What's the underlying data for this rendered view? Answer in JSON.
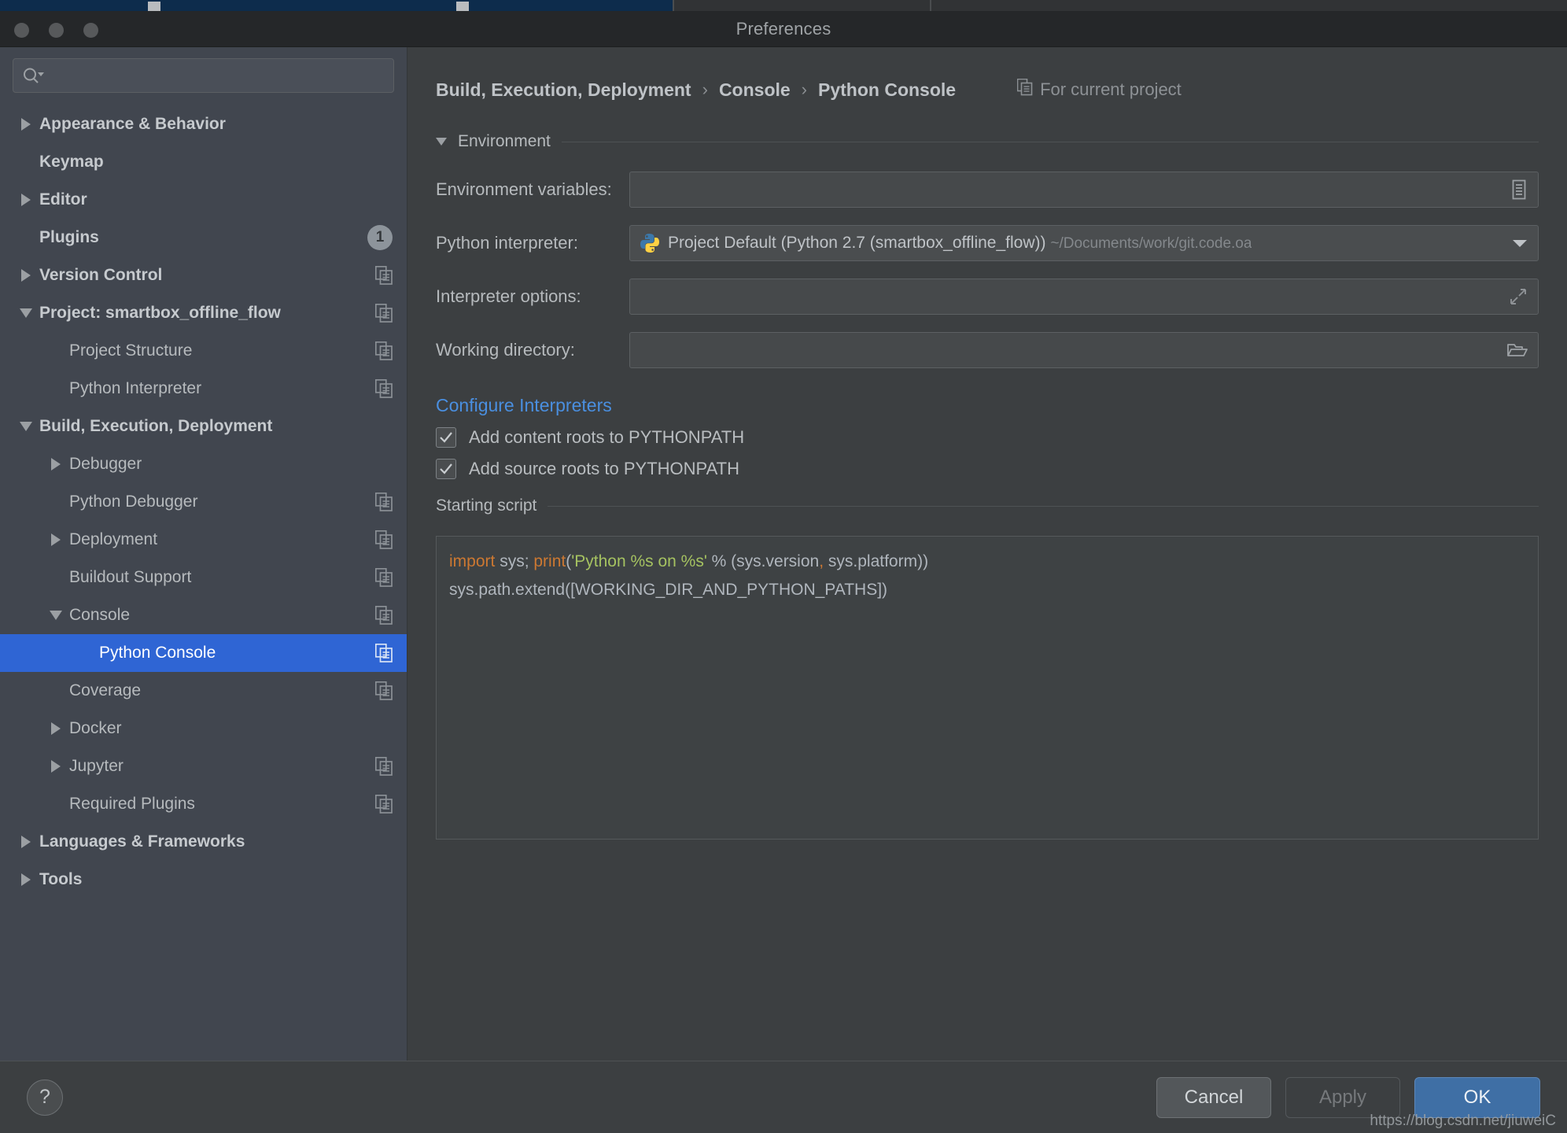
{
  "window": {
    "title": "Preferences",
    "traffic_lights": [
      "close-button",
      "minimize-button",
      "zoom-button"
    ]
  },
  "sidebar": {
    "search": {
      "value": "",
      "placeholder": ""
    },
    "items": [
      {
        "label": "Appearance & Behavior",
        "indent": 0,
        "twisty": "right",
        "bold": true,
        "copy": false,
        "badge": null,
        "selected": false
      },
      {
        "label": "Keymap",
        "indent": 0,
        "twisty": "none",
        "bold": true,
        "copy": false,
        "badge": null,
        "selected": false
      },
      {
        "label": "Editor",
        "indent": 0,
        "twisty": "right",
        "bold": true,
        "copy": false,
        "badge": null,
        "selected": false
      },
      {
        "label": "Plugins",
        "indent": 0,
        "twisty": "none",
        "bold": true,
        "copy": false,
        "badge": "1",
        "selected": false
      },
      {
        "label": "Version Control",
        "indent": 0,
        "twisty": "right",
        "bold": true,
        "copy": true,
        "badge": null,
        "selected": false
      },
      {
        "label": "Project: smartbox_offline_flow",
        "indent": 0,
        "twisty": "down",
        "bold": true,
        "copy": true,
        "badge": null,
        "selected": false
      },
      {
        "label": "Project Structure",
        "indent": 1,
        "twisty": "none",
        "bold": false,
        "copy": true,
        "badge": null,
        "selected": false
      },
      {
        "label": "Python Interpreter",
        "indent": 1,
        "twisty": "none",
        "bold": false,
        "copy": true,
        "badge": null,
        "selected": false
      },
      {
        "label": "Build, Execution, Deployment",
        "indent": 0,
        "twisty": "down",
        "bold": true,
        "copy": false,
        "badge": null,
        "selected": false
      },
      {
        "label": "Debugger",
        "indent": 1,
        "twisty": "right",
        "bold": false,
        "copy": false,
        "badge": null,
        "selected": false
      },
      {
        "label": "Python Debugger",
        "indent": 1,
        "twisty": "none",
        "bold": false,
        "copy": true,
        "badge": null,
        "selected": false
      },
      {
        "label": "Deployment",
        "indent": 1,
        "twisty": "right",
        "bold": false,
        "copy": true,
        "badge": null,
        "selected": false
      },
      {
        "label": "Buildout Support",
        "indent": 1,
        "twisty": "none",
        "bold": false,
        "copy": true,
        "badge": null,
        "selected": false
      },
      {
        "label": "Console",
        "indent": 1,
        "twisty": "down",
        "bold": false,
        "copy": true,
        "badge": null,
        "selected": false
      },
      {
        "label": "Python Console",
        "indent": 2,
        "twisty": "none",
        "bold": false,
        "copy": true,
        "badge": null,
        "selected": true
      },
      {
        "label": "Coverage",
        "indent": 1,
        "twisty": "none",
        "bold": false,
        "copy": true,
        "badge": null,
        "selected": false
      },
      {
        "label": "Docker",
        "indent": 1,
        "twisty": "right",
        "bold": false,
        "copy": false,
        "badge": null,
        "selected": false
      },
      {
        "label": "Jupyter",
        "indent": 1,
        "twisty": "right",
        "bold": false,
        "copy": true,
        "badge": null,
        "selected": false
      },
      {
        "label": "Required Plugins",
        "indent": 1,
        "twisty": "none",
        "bold": false,
        "copy": true,
        "badge": null,
        "selected": false
      },
      {
        "label": "Languages & Frameworks",
        "indent": 0,
        "twisty": "right",
        "bold": true,
        "copy": false,
        "badge": null,
        "selected": false
      },
      {
        "label": "Tools",
        "indent": 0,
        "twisty": "right",
        "bold": true,
        "copy": false,
        "badge": null,
        "selected": false
      }
    ]
  },
  "main": {
    "breadcrumb": {
      "part1": "Build, Execution, Deployment",
      "sep1": "›",
      "part2": "Console",
      "sep2": "›",
      "part3": "Python Console",
      "scope_label": "For current project"
    },
    "environment_section": {
      "title": "Environment",
      "expanded": true
    },
    "fields": {
      "env_vars": {
        "label": "Environment variables:",
        "value": "",
        "icon": "list-icon"
      },
      "python_interpreter": {
        "label": "Python interpreter:",
        "value": "Project Default (Python 2.7 (smartbox_offline_flow))",
        "path_hint": "~/Documents/work/git.code.oa",
        "icon": "python-logo-icon",
        "trailing_icon": "chevron-down-icon"
      },
      "interpreter_options": {
        "label": "Interpreter options:",
        "value": "",
        "icon": "expand-icon"
      },
      "working_directory": {
        "label": "Working directory:",
        "value": "",
        "icon": "folder-icon"
      }
    },
    "configure_link": "Configure Interpreters",
    "checkboxes": [
      {
        "label": "Add content roots to PYTHONPATH",
        "checked": true
      },
      {
        "label": "Add source roots to PYTHONPATH",
        "checked": true
      }
    ],
    "starting_script": {
      "title": "Starting script",
      "line1": {
        "kw_import": "import",
        "mid": " sys; ",
        "kw_print": "print",
        "paren_open": "(",
        "string": "'Python %s on %s'",
        "tail_a": " % (sys.version",
        "comma": ",",
        "tail_b": " sys.platform))"
      },
      "line2": "sys.path.extend([WORKING_DIR_AND_PYTHON_PATHS])"
    }
  },
  "footer": {
    "help_glyph": "?",
    "cancel_label": "Cancel",
    "apply_label": "Apply",
    "ok_label": "OK"
  },
  "watermark": "https://blog.csdn.net/jiuweiC",
  "colors": {
    "accent_blue": "#2f65d4",
    "link_blue": "#4a8fe0",
    "ok_button": "#3f6fa5",
    "sidebar_bg": "#41464f",
    "panel_bg": "#3c3f41",
    "titlebar_bg": "#252729",
    "keyword_orange": "#cc7832",
    "string_green": "#a5c261",
    "badge_gray": "#8d949b"
  }
}
